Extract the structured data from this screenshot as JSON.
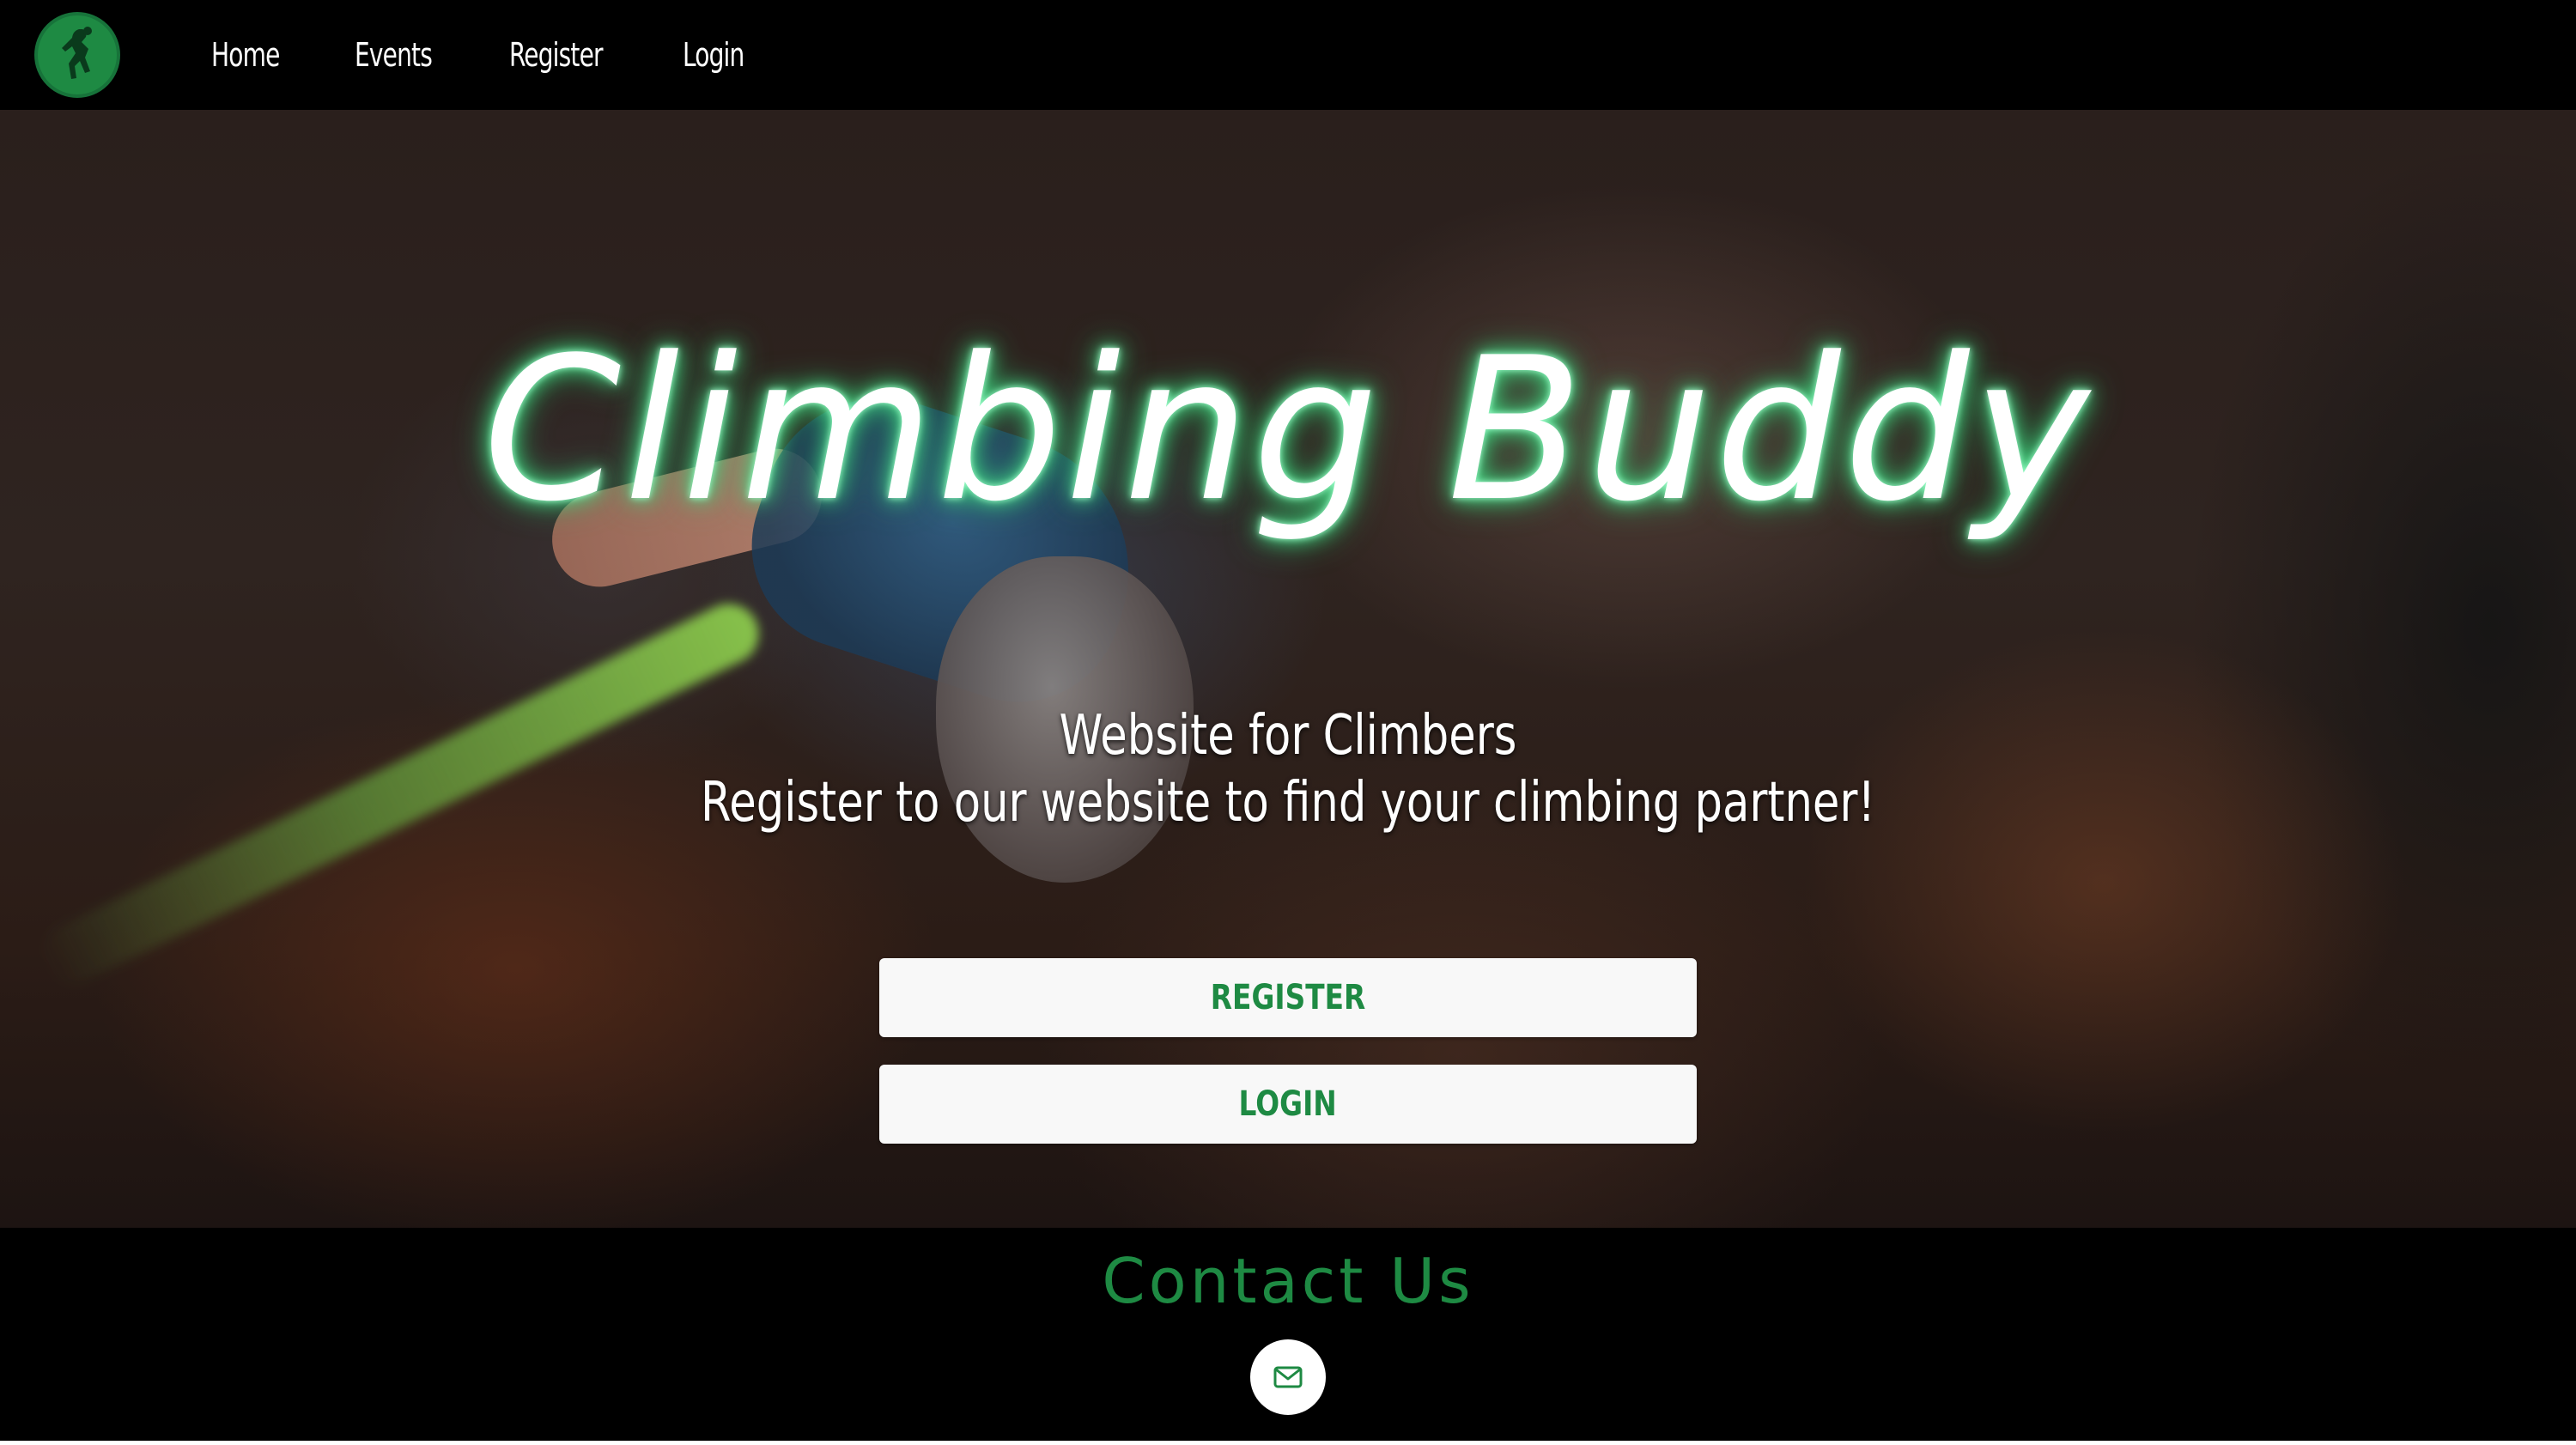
{
  "nav": {
    "items": [
      {
        "label": "Home"
      },
      {
        "label": "Events"
      },
      {
        "label": "Register"
      },
      {
        "label": "Login"
      }
    ]
  },
  "hero": {
    "title": "Climbing Buddy",
    "subtitle_line1": "Website for Climbers",
    "subtitle_line2": "Register to our website to find your climbing partner!",
    "register_button": "REGISTER",
    "login_button": "LOGIN"
  },
  "footer": {
    "title": "Contact Us"
  },
  "colors": {
    "brand_green": "#1e8a43",
    "glow_green": "#4ee78f",
    "background": "#000000"
  }
}
